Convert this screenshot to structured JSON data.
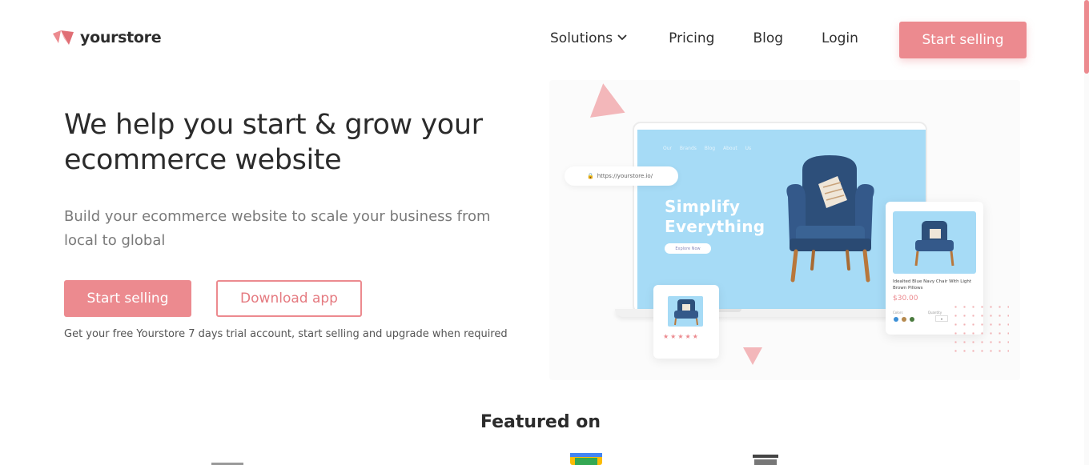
{
  "brand": {
    "name": "yourstore",
    "accent": "#ec8a8f"
  },
  "nav": {
    "items": [
      {
        "label": "Solutions",
        "has_dropdown": true
      },
      {
        "label": "Pricing"
      },
      {
        "label": "Blog"
      },
      {
        "label": "Login"
      }
    ],
    "cta_label": "Start selling"
  },
  "hero": {
    "title": "We help you start & grow your ecommerce website",
    "subtitle": "Build your ecommerce website to scale your business from local to global",
    "primary_button": "Start selling",
    "secondary_button": "Download app",
    "note": "Get your free Yourstore 7 days trial account, start selling and upgrade when required"
  },
  "illustration": {
    "url": "https://yourstore.io/",
    "screen_nav": "Our Brands Blog About Us",
    "headline_line1": "Simplify",
    "headline_line2": "Everything",
    "screen_cta": "Explore Now",
    "stars": "★★★★★",
    "product_name": "Idealted Blue Navy Chair With Light Brown Pillows",
    "product_price": "$30.00",
    "product_labels": "Colors Quantity",
    "swatches": [
      "#3b8fd6",
      "#b5894e",
      "#4a7a3e"
    ]
  },
  "featured": {
    "title": "Featured on"
  }
}
